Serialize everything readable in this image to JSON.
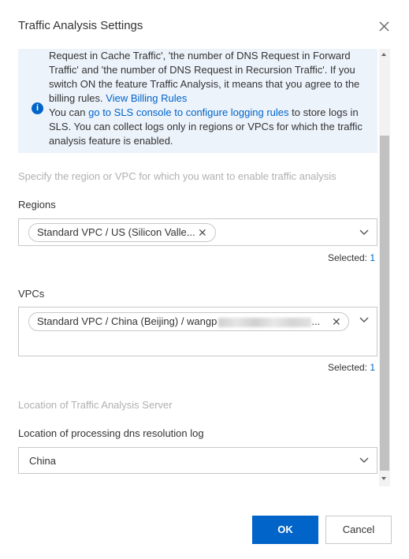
{
  "dialog": {
    "title": "Traffic Analysis Settings"
  },
  "notice": {
    "line1": "Request in Cache Traffic', 'the number of DNS Request in Forward",
    "line2": "Traffic' and 'the number of DNS Request in Recursion Traffic'. If you",
    "line3": "switch ON the feature Traffic Analysis, it means that you agree to the",
    "line4_text": "billing rules. ",
    "line4_link": "View Billing Rules",
    "line5_text": "You can ",
    "line5_link": "go to SLS console to configure logging rules",
    "line5_suffix": " to store logs in",
    "line6": "SLS. You can collect logs only in regions or VPCs for which the traffic",
    "line7": "analysis feature is enabled.",
    "icon": "info-icon"
  },
  "scope": {
    "hint": "Specify the region or VPC for which you want to enable traffic analysis"
  },
  "regions": {
    "label": "Regions",
    "tag": "Standard VPC / US (Silicon Valle...",
    "selected_label": "Selected: ",
    "selected_count": "1"
  },
  "vpcs": {
    "label": "VPCs",
    "tag": "Standard VPC / China (Beijing) / wangp",
    "tag_suffix": "...",
    "selected_label": "Selected: ",
    "selected_count": "1"
  },
  "server": {
    "section_title": "Location of Traffic Analysis Server",
    "log_label": "Location of processing dns resolution log",
    "log_value": "China"
  },
  "footer": {
    "ok_label": "OK",
    "cancel_label": "Cancel"
  },
  "colors": {
    "primary": "#0064c8",
    "notice_bg": "#edf3fb"
  }
}
